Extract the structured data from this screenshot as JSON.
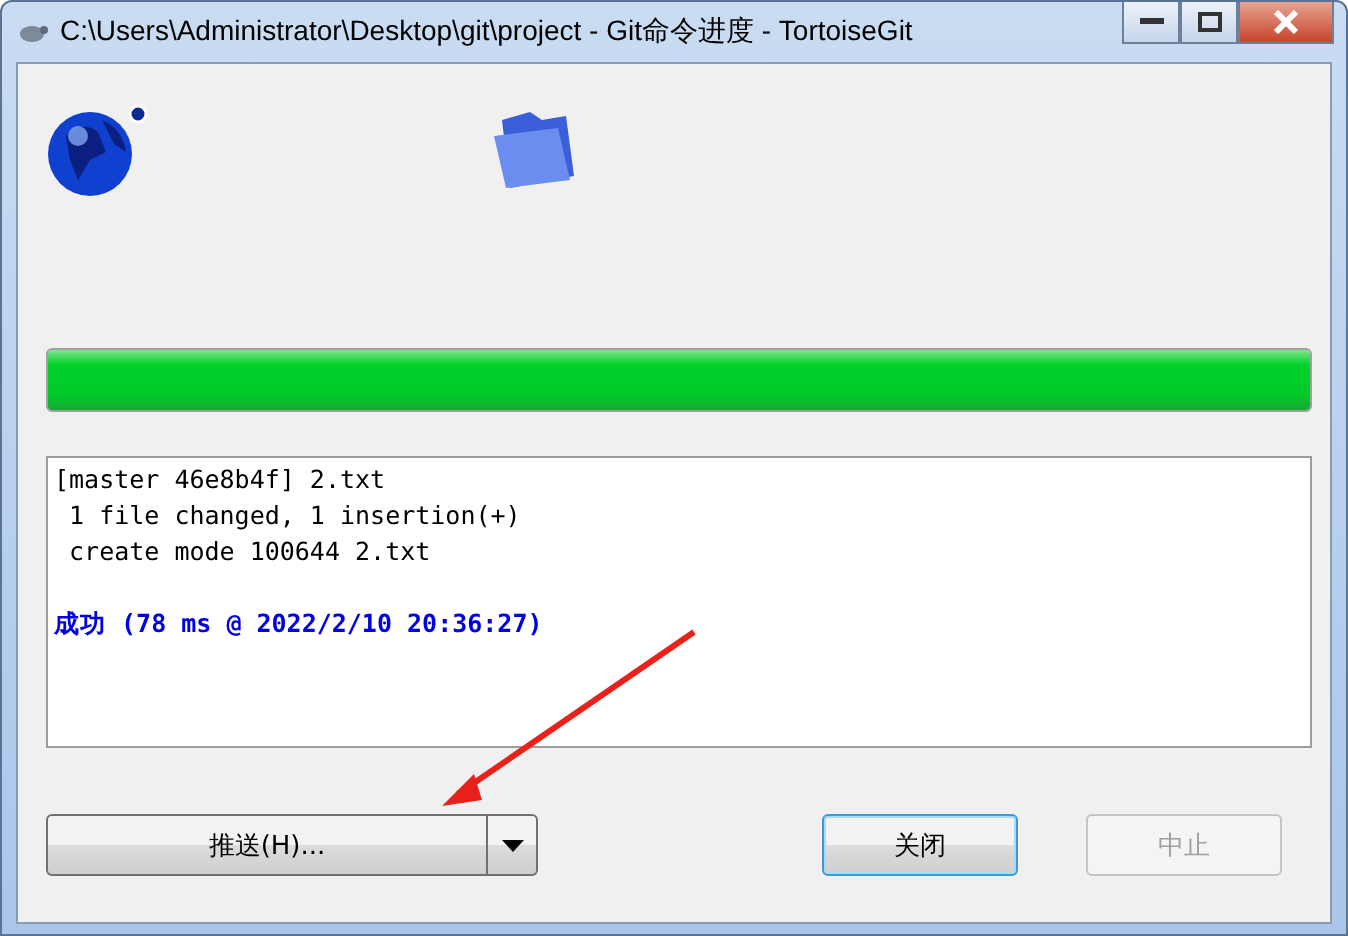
{
  "window": {
    "title": "C:\\Users\\Administrator\\Desktop\\git\\project - Git命令进度 - TortoiseGit"
  },
  "progress": {
    "level": 1
  },
  "log": {
    "lines": [
      {
        "kind": "plain",
        "text": "[master 46e8b4f] 2.txt"
      },
      {
        "kind": "plain",
        "text": " 1 file changed, 1 insertion(+)"
      },
      {
        "kind": "plain",
        "text": " create mode 100644 2.txt"
      },
      {
        "kind": "blank"
      },
      {
        "kind": "status",
        "text": "成功 (78 ms @ 2022/2/10 20:36:27)"
      }
    ]
  },
  "buttons": [
    {
      "kind": "split",
      "label": "推送(H)...",
      "disabled": false,
      "default": false
    },
    {
      "kind": "plain",
      "label": "关闭",
      "disabled": false,
      "default": true
    },
    {
      "kind": "plain",
      "label": "中止",
      "disabled": true,
      "default": false
    }
  ]
}
